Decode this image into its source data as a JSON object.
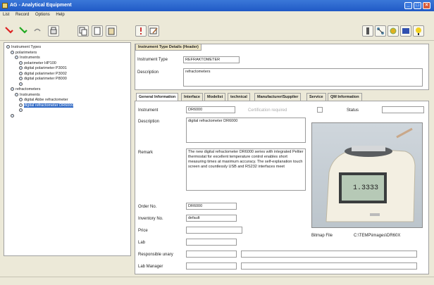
{
  "window": {
    "title": "AG - Analytical Equipment"
  },
  "menu": {
    "items": [
      "List",
      "Record",
      "Options",
      "Help"
    ]
  },
  "toolbar": {
    "icons": [
      "red-arrow-icon",
      "green-arrow-icon",
      "undo-icon",
      "print-icon",
      "copy-icon",
      "page-icon",
      "paste-icon",
      "info-icon",
      "edit-icon",
      "bottle-icon",
      "network-icon",
      "gears-icon",
      "display-icon",
      "help-icon"
    ]
  },
  "tree": {
    "nodes": [
      {
        "label": "Instrument Types",
        "level": 0
      },
      {
        "label": "polarimeters",
        "level": 1
      },
      {
        "label": "Instruments",
        "level": 2
      },
      {
        "label": "polarimeter HP100",
        "level": 3
      },
      {
        "label": "digital polarimeter P3001",
        "level": 3
      },
      {
        "label": "digital polarimeter P3002",
        "level": 3
      },
      {
        "label": "digital polarimeter P8000",
        "level": 3
      },
      {
        "label": "",
        "level": 3
      },
      {
        "label": "refractometers",
        "level": 1
      },
      {
        "label": "Instruments",
        "level": 2
      },
      {
        "label": "digital Abbe refractometer",
        "level": 3
      },
      {
        "label": "digital refractometer DR6000",
        "level": 3,
        "selected": true
      },
      {
        "label": "",
        "level": 3
      },
      {
        "label": "",
        "level": 1
      }
    ]
  },
  "header": {
    "tab": "Instrument Type Details (Header)",
    "type_label": "Instrument Type",
    "type_value": "REFRAKTOMETER",
    "desc_label": "Description",
    "desc_value": "refractometers"
  },
  "tabs": [
    {
      "label": "General Information",
      "active": true
    },
    {
      "label": "Interface"
    },
    {
      "label": "Modelist"
    },
    {
      "label": "technical"
    },
    {
      "label": "Manufacturer/Supplier"
    },
    {
      "label": "Service"
    },
    {
      "label": "QM Information"
    }
  ],
  "general": {
    "instrument_label": "Instrument",
    "instrument_value": "DR6000",
    "cert_label": "Certification required",
    "status_label": "Status",
    "status_value": "",
    "description_label": "Description",
    "description_value": "digital refractometer DR6000",
    "remark_label": "Remark",
    "remark_value": "The new digital refractometer DR6000 series with integrated Peltier thermostat for excellent temperature control enables short measuring times at maximum accuracy. The self-explanation touch screen and countlessly USB and RS232 interfaces meet",
    "order_label": "Order No.",
    "order_value": "DR6000",
    "inventory_label": "Inventory No.",
    "inventory_value": "default",
    "price_label": "Price",
    "price_value": "",
    "lab_label": "Lab",
    "lab_value": "",
    "resp_label": "Responsible unary",
    "resp_value": "",
    "labmgr_label": "Lab Manager",
    "labmgr_value": "",
    "bitmap_label": "Bitmap File",
    "bitmap_value": "C:\\TEMP\\images\\DR60X",
    "display_reading": "1.3333"
  }
}
